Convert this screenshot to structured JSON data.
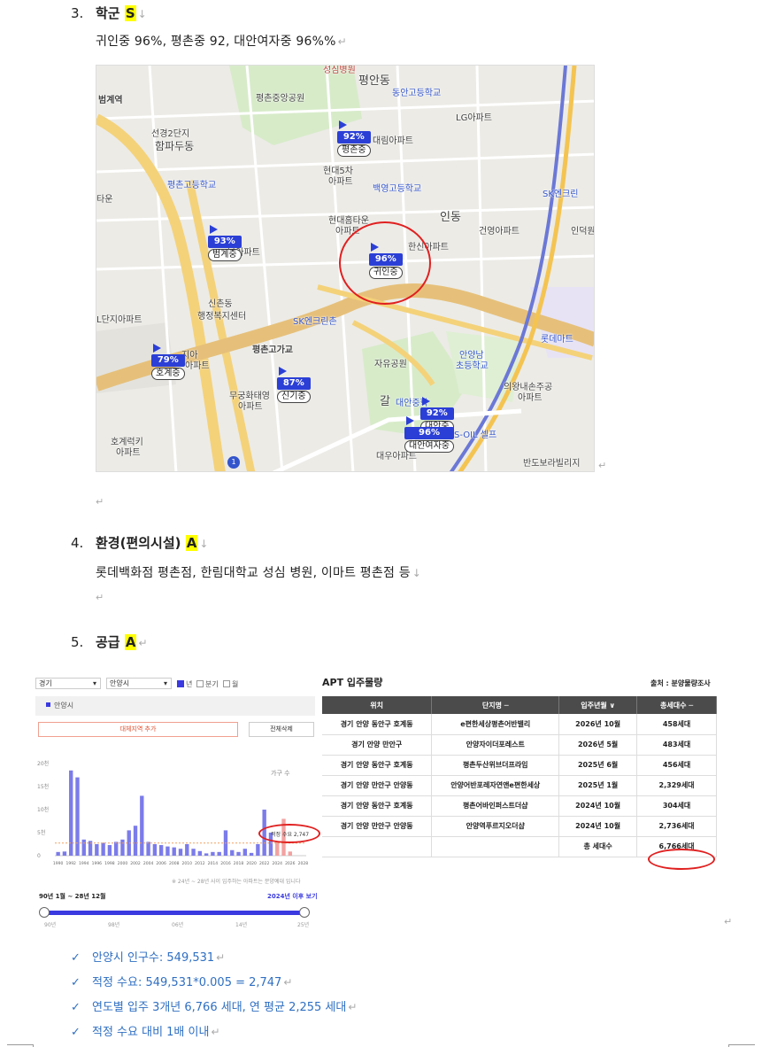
{
  "section3": {
    "num": "3.",
    "title": "학군",
    "grade": "S",
    "text": "귀인중 96%, 평촌중 92, 대안여자중 96%%"
  },
  "map": {
    "labels": {
      "seongsim": "성심병원",
      "pyeongan": "평안동",
      "dongan_high": "동안고등학교",
      "beomgye_station": "범계역",
      "pyeongchon_park": "평촌중앙공원",
      "lg_apt": "LG아파트",
      "seongyeong": "선경2단지",
      "hamparu": "함파두동",
      "daerim": "대림아파트",
      "hyundai5": "현대5차",
      "apt1": "아파트",
      "baekyoung": "백영고등학교",
      "pyeongchon_high": "평촌고등학교",
      "taun": "타운",
      "sk_green": "SK엔크린",
      "hyundai_hometown": "현대홈타운",
      "apt2": "아파트",
      "gwiin_dong": "인동",
      "geonyeong": "건영아파트",
      "indeok": "인덕원",
      "hansin": "한신아파트",
      "beomgye_apt": "남아파트",
      "sinchon": "신촌동",
      "welfare": "행정복지센터",
      "sk_encleanchon": "SK엔크린촌",
      "danji": "L단지아파트",
      "lotte": "롯데마트",
      "jia": "지아",
      "jia_apt": "아파트",
      "pyeongchon_overpass": "평촌고가교",
      "jayu_park": "자유공원",
      "anyang_nam": "안양남",
      "elementary": "초등학교",
      "uiyang": "의왕내손주공",
      "apt3": "아파트",
      "mugung": "무궁화태영",
      "apt4": "아파트",
      "gal": "갈",
      "daean_middle": "대안중학",
      "s_oil": "S-OIL 셀프",
      "hogye": "호계럭키",
      "apt5": "아파트",
      "daewoo": "대우아파트",
      "bando": "반도보라빌리지"
    },
    "schools": [
      {
        "pct": "92%",
        "name": "평촌중"
      },
      {
        "pct": "93%",
        "name": "범계중"
      },
      {
        "pct": "96%",
        "name": "귀인중"
      },
      {
        "pct": "79%",
        "name": "호계중"
      },
      {
        "pct": "87%",
        "name": "신기중"
      },
      {
        "pct": "92%",
        "name": "대안중"
      },
      {
        "pct": "96%",
        "name": "대안여자중"
      }
    ],
    "number_badge": "1"
  },
  "section4": {
    "num": "4.",
    "title": "환경(편의시설)",
    "grade": "A",
    "text": "롯데백화점 평촌점, 한림대학교 성심 병원, 이마트 평촌점 등"
  },
  "section5": {
    "num": "5.",
    "title": "공급",
    "grade": "A"
  },
  "supply": {
    "select_region": "경기",
    "select_city": "안양시",
    "check_year": "년",
    "check_quarter": "분기",
    "check_month": "월",
    "legend": "안양시",
    "add_region": "대체지역 추가",
    "delete_all": "전체삭제",
    "unit_label": "가구 수",
    "demand_label": "적정 수요 2,747",
    "footnote": "※ 24년 ~ 28년 사이 입주하는 아파트는 분양예대 입니다",
    "period": "90년 1월 ~ 28년 12월",
    "after": "2024년 이후 보기",
    "slider_ticks": [
      "90년",
      "98년",
      "06년",
      "14년",
      "25년"
    ],
    "y_ticks": [
      "20천",
      "15천",
      "10천",
      "5천",
      "0"
    ],
    "apt_title": "APT 입주물량",
    "source": "출처 : 분양물량조사",
    "table": {
      "headers": [
        "위치",
        "단지명 ─",
        "입주년월 ∨",
        "총세대수 ─"
      ],
      "rows": [
        [
          "경기 안양 동안구 호계동",
          "e편한세상평촌어반밸리",
          "2026년 10월",
          "458세대"
        ],
        [
          "경기 안양 만안구",
          "안양자이더포레스트",
          "2026년 5월",
          "483세대"
        ],
        [
          "경기 안양 동안구 호계동",
          "평촌두산위브더프라임",
          "2025년 6월",
          "456세대"
        ],
        [
          "경기 안양 만안구 안양동",
          "안양어반포레자연앤e편한세상",
          "2025년 1월",
          "2,329세대"
        ],
        [
          "경기 안양 동안구 호계동",
          "평촌어바인퍼스트더샵",
          "2024년 10월",
          "304세대"
        ],
        [
          "경기 안양 만안구 안양동",
          "안양역푸르지오더샵",
          "2024년 10월",
          "2,736세대"
        ]
      ],
      "total_label": "총 세대수",
      "total_value": "6,766세대"
    }
  },
  "chart_data": {
    "type": "bar",
    "title": "",
    "ylabel": "가구 수",
    "ylim": [
      0,
      20000
    ],
    "categories": [
      "1990",
      "1991",
      "1992",
      "1993",
      "1994",
      "1995",
      "1996",
      "1997",
      "1998",
      "1999",
      "2000",
      "2001",
      "2002",
      "2003",
      "2004",
      "2005",
      "2006",
      "2007",
      "2008",
      "2009",
      "2010",
      "2011",
      "2012",
      "2013",
      "2014",
      "2015",
      "2016",
      "2017",
      "2018",
      "2019",
      "2020",
      "2021",
      "2022",
      "2023",
      "2024",
      "2025",
      "2026",
      "2027",
      "2028"
    ],
    "x_tick_labels": [
      "1990",
      "1992",
      "1994",
      "1996",
      "1998",
      "2000",
      "2002",
      "2004",
      "2006",
      "2008",
      "2010",
      "2012",
      "2014",
      "2016",
      "2018",
      "2020",
      "2022",
      "2024",
      "2026",
      "2028"
    ],
    "series": [
      {
        "name": "안양시",
        "values": [
          800,
          900,
          18500,
          17000,
          3500,
          3200,
          2500,
          2800,
          2300,
          3000,
          3500,
          5500,
          6500,
          13000,
          3000,
          2500,
          2300,
          2000,
          1800,
          1500,
          2500,
          1500,
          1000,
          500,
          800,
          800,
          5500,
          1200,
          800,
          1500,
          600,
          2500,
          10000,
          5000,
          3000,
          8000,
          900,
          0,
          0
        ]
      }
    ],
    "reference_line": {
      "value": 2747
    }
  },
  "checks": [
    "안양시 인구수: 549,531",
    "적정 수요: 549,531*0.005 = 2,747",
    "연도별 입주 3개년 6,766 세대, 연 평균 2,255 세대",
    "적정 수요 대비 1배 이내"
  ],
  "icons": {
    "check": "✓",
    "return": "↵",
    "down": "↓"
  }
}
